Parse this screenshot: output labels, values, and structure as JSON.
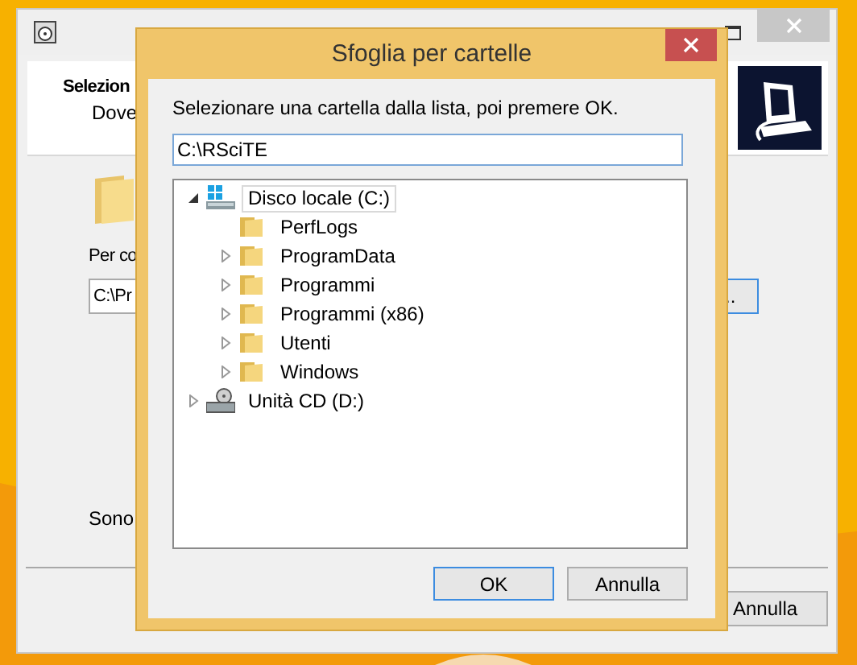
{
  "back_window": {
    "header_title": "Selezion",
    "header_subtitle": "Dove",
    "path_label": "Per co",
    "path_value": "C:\\Pr",
    "browse_button": "..",
    "footer_text": "Sono",
    "cancel_button": "Annulla"
  },
  "dialog": {
    "title": "Sfoglia per cartelle",
    "instruction": "Selezionare una cartella dalla lista, poi premere OK.",
    "path_value": "C:\\RSciTE",
    "tree": [
      {
        "kind": "drive",
        "label": "Disco locale (C:)",
        "expanded": true,
        "selected": true,
        "children": [
          {
            "kind": "folder",
            "label": "PerfLogs",
            "expandable": false,
            "expanded": false,
            "selected": false
          },
          {
            "kind": "folder",
            "label": "ProgramData",
            "expandable": true,
            "expanded": false,
            "selected": false
          },
          {
            "kind": "folder",
            "label": "Programmi",
            "expandable": true,
            "expanded": false,
            "selected": false
          },
          {
            "kind": "folder",
            "label": "Programmi (x86)",
            "expandable": true,
            "expanded": false,
            "selected": false
          },
          {
            "kind": "folder",
            "label": "Utenti",
            "expandable": true,
            "expanded": false,
            "selected": false
          },
          {
            "kind": "folder",
            "label": "Windows",
            "expandable": true,
            "expanded": false,
            "selected": false
          }
        ],
        "expandable": true
      },
      {
        "kind": "cd",
        "label": "Unità CD (D:)",
        "expandable": true,
        "expanded": false,
        "selected": false
      }
    ],
    "buttons": [
      {
        "label": "OK",
        "default": true
      },
      {
        "label": "Annulla",
        "default": false
      }
    ]
  }
}
